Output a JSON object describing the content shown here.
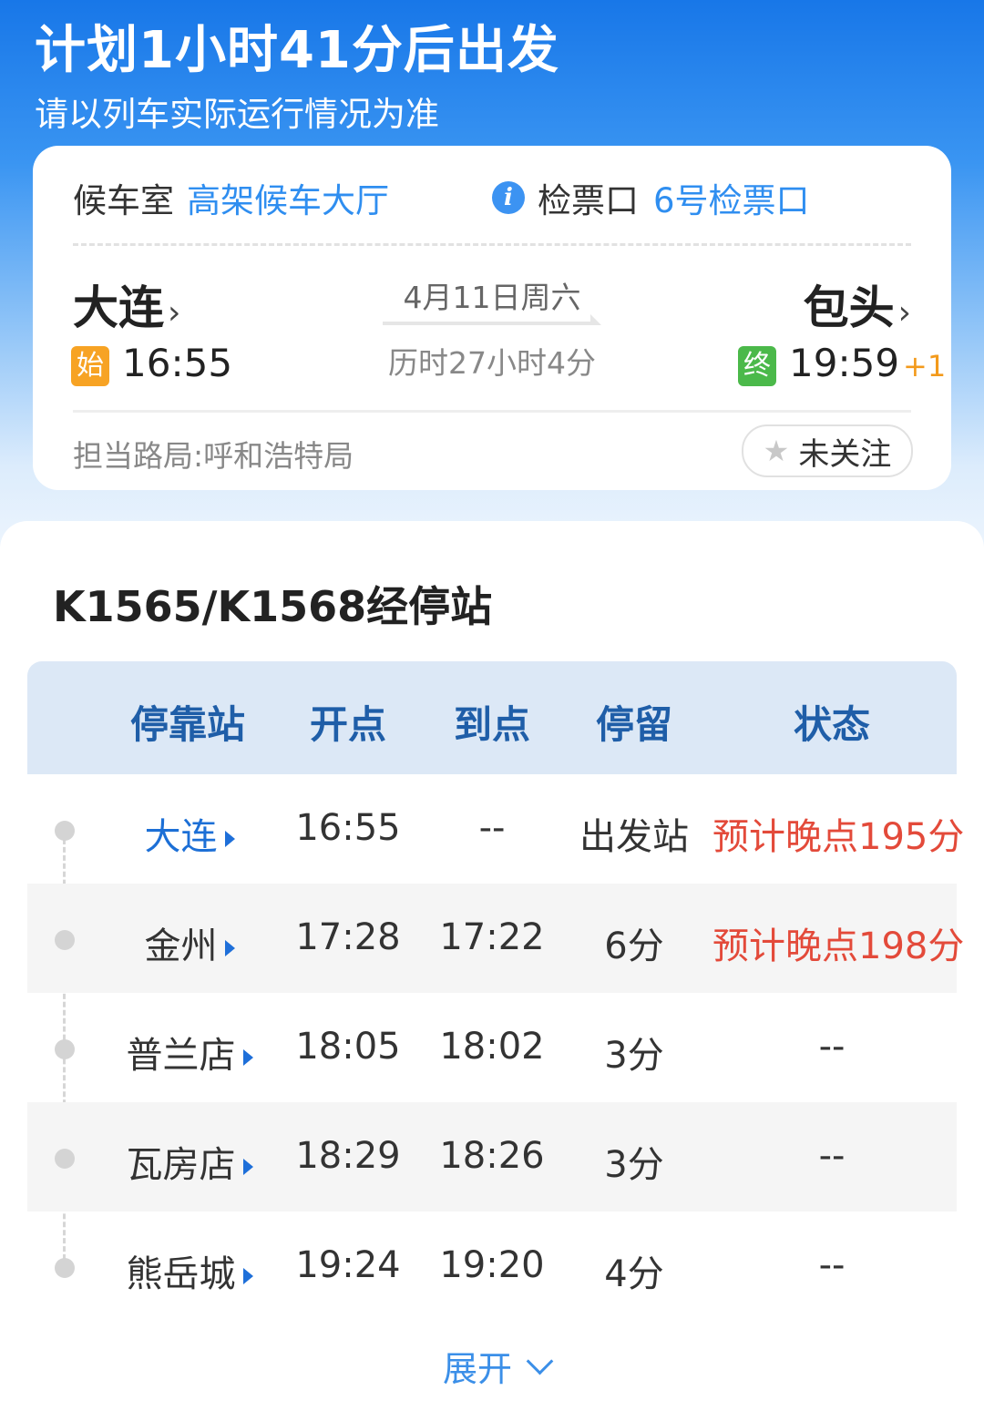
{
  "header": {
    "title": "计划1小时41分后出发",
    "subtitle": "请以列车实际运行情况为准"
  },
  "info_card": {
    "waiting_room_label": "候车室",
    "waiting_room_value": "高架候车大厅",
    "gate_label": "检票口",
    "gate_value": "6号检票口",
    "info_icon_glyph": "i",
    "from_station": "大连",
    "to_station": "包头",
    "chevron": "›",
    "date": "4月11日周六",
    "duration": "历时27小时4分",
    "start_badge": "始",
    "end_badge": "终",
    "depart_time": "16:55",
    "arrive_time": "19:59",
    "arrive_day_offset": "+1",
    "bureau": "担当路局:呼和浩特局",
    "follow_label": "未关注",
    "star_glyph": "★"
  },
  "stops": {
    "title": "K1565/K1568经停站",
    "columns": [
      "停靠站",
      "开点",
      "到点",
      "停留",
      "状态"
    ],
    "rows": [
      {
        "station": "大连",
        "depart": "16:55",
        "arrive": "--",
        "stay": "出发站",
        "status": "预计晚点195分"
      },
      {
        "station": "金州",
        "depart": "17:28",
        "arrive": "17:22",
        "stay": "6分",
        "status": "预计晚点198分"
      },
      {
        "station": "普兰店",
        "depart": "18:05",
        "arrive": "18:02",
        "stay": "3分",
        "status": "--"
      },
      {
        "station": "瓦房店",
        "depart": "18:29",
        "arrive": "18:26",
        "stay": "3分",
        "status": "--"
      },
      {
        "station": "熊岳城",
        "depart": "19:24",
        "arrive": "19:20",
        "stay": "4分",
        "status": "--"
      }
    ],
    "expand_label": "展开"
  },
  "colors": {
    "accent_blue": "#2f8ef0",
    "late_red": "#e34a3a",
    "start_badge": "#f7a324",
    "end_badge": "#4bb94a",
    "plus_orange": "#f39a1b"
  }
}
